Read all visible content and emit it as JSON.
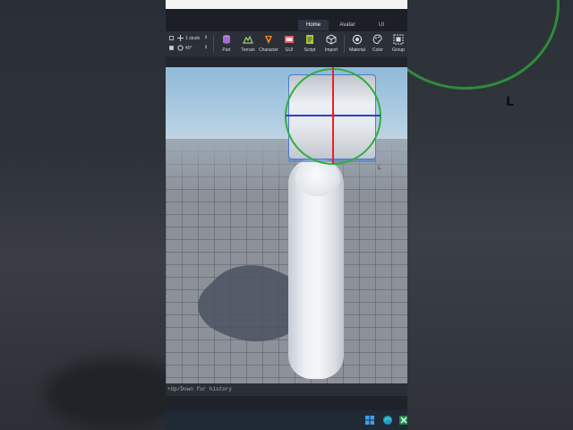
{
  "tabs": [
    {
      "label": "Home",
      "active": true
    },
    {
      "label": "Avatar",
      "active": false
    },
    {
      "label": "UI",
      "active": false
    }
  ],
  "ribbon": {
    "move_step": "1 studs",
    "rotate_step": "45°",
    "tools": [
      {
        "label": "Part",
        "icon": "part-icon"
      },
      {
        "label": "Terrain",
        "icon": "terrain-icon"
      },
      {
        "label": "Character",
        "icon": "character-icon"
      },
      {
        "label": "GUI",
        "icon": "gui-icon"
      },
      {
        "label": "Script",
        "icon": "script-icon"
      },
      {
        "label": "Import",
        "icon": "import-icon"
      },
      {
        "label": "Material",
        "icon": "material-icon"
      },
      {
        "label": "Color",
        "icon": "color-icon"
      },
      {
        "label": "Group",
        "icon": "group-icon"
      }
    ]
  },
  "command_bar": {
    "hint": "+Up/Down for history"
  },
  "colors": {
    "x_axis": "#e8222a",
    "y_axis": "#2a3fd6",
    "rotate_ring": "#2fae3c",
    "selection": "#4c7bd0",
    "toolbar_bg": "#2b3038"
  }
}
